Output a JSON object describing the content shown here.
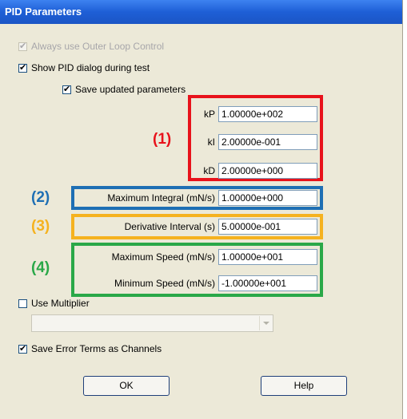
{
  "window": {
    "title": "PID Parameters"
  },
  "options": {
    "outer_loop_label": "Always use Outer Loop Control",
    "show_dialog_label": "Show PID dialog during test",
    "save_params_label": "Save updated parameters",
    "use_multiplier_label": "Use Multiplier",
    "save_error_label": "Save Error Terms as Channels",
    "check_mark": "✔"
  },
  "annotations": {
    "a1": "(1)",
    "a2": "(2)",
    "a3": "(3)",
    "a4": "(4)",
    "colors": {
      "a1": "#e8121b",
      "a2": "#1e6fb4",
      "a3": "#f5b21f",
      "a4": "#2aa848"
    }
  },
  "gains": {
    "kp_label": "kP",
    "kp_value": "1.00000e+002",
    "ki_label": "kI",
    "ki_value": "2.00000e-001",
    "kd_label": "kD",
    "kd_value": "2.00000e+000"
  },
  "limits": {
    "max_integral_label": "Maximum Integral (mN/s)",
    "max_integral_value": "1.00000e+000",
    "deriv_interval_label": "Derivative Interval (s)",
    "deriv_interval_value": "5.00000e-001",
    "max_speed_label": "Maximum Speed (mN/s)",
    "max_speed_value": "1.00000e+001",
    "min_speed_label": "Minimum Speed (mN/s)",
    "min_speed_value": "-1.00000e+001"
  },
  "multiplier": {
    "selected": ""
  },
  "buttons": {
    "ok": "OK",
    "help": "Help"
  }
}
